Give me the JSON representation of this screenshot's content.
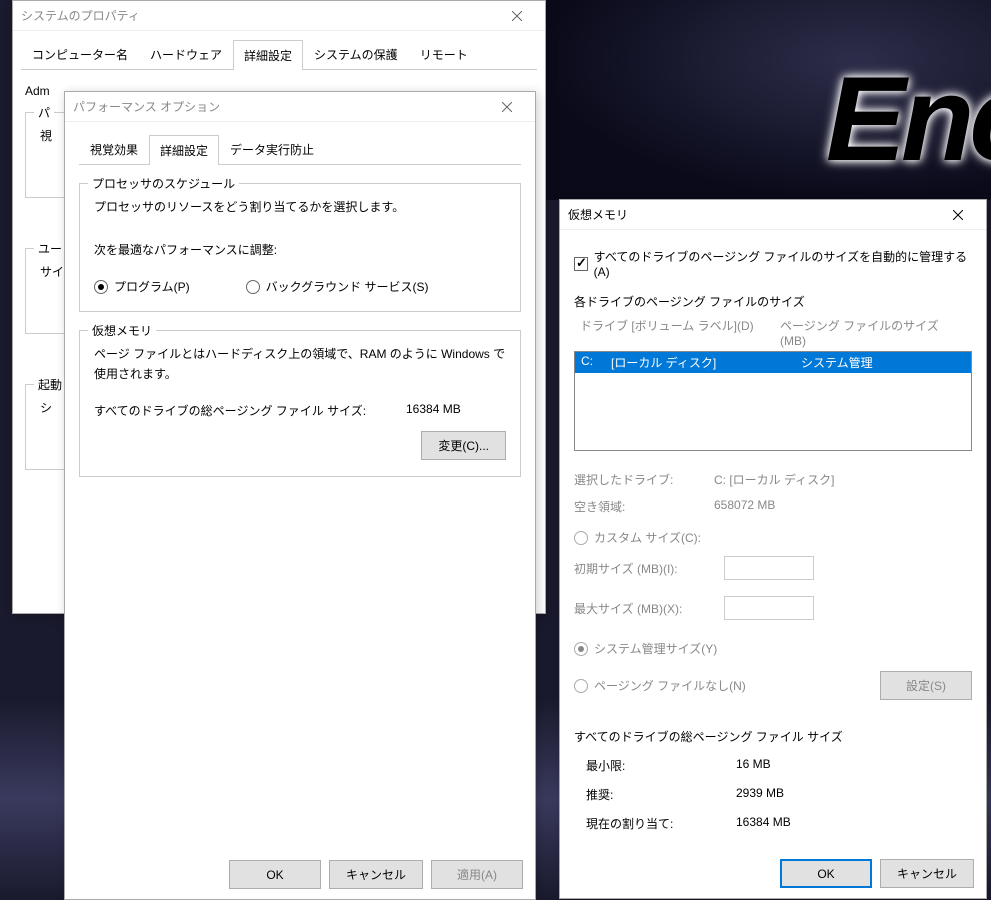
{
  "dlg1": {
    "title": "システムのプロパティ",
    "tabs": [
      "コンピューター名",
      "ハードウェア",
      "詳細設定",
      "システムの保護",
      "リモート"
    ],
    "active_tab": 2,
    "admin_label": "Adm",
    "group_perf": "パ",
    "group_perf_sub": "視",
    "group_user": "ユー",
    "group_user_sub": "サイ",
    "group_start": "起動",
    "group_start_sub": "シ"
  },
  "dlg2": {
    "title": "パフォーマンス オプション",
    "tabs": [
      "視覚効果",
      "詳細設定",
      "データ実行防止"
    ],
    "active_tab": 1,
    "processor": {
      "title": "プロセッサのスケジュール",
      "desc": "プロセッサのリソースをどう割り当てるかを選択します。",
      "adjust_label": "次を最適なパフォーマンスに調整:",
      "opt_programs": "プログラム(P)",
      "opt_background": "バックグラウンド サービス(S)"
    },
    "vm": {
      "title": "仮想メモリ",
      "desc": "ページ ファイルとはハードディスク上の領域で、RAM のように Windows で使用されます。",
      "total_label": "すべてのドライブの総ページング ファイル サイズ:",
      "total_value": "16384 MB",
      "change_btn": "変更(C)..."
    },
    "buttons": {
      "ok": "OK",
      "cancel": "キャンセル",
      "apply": "適用(A)"
    }
  },
  "dlg3": {
    "title": "仮想メモリ",
    "auto_manage": "すべてのドライブのページング ファイルのサイズを自動的に管理する(A)",
    "drives_label": "各ドライブのページング ファイルのサイズ",
    "col_drive": "ドライブ  [ボリューム ラベル](D)",
    "col_size": "ページング ファイルのサイズ (MB)",
    "drive_row": {
      "drive": "C:",
      "label": "[ローカル ディスク]",
      "size": "システム管理"
    },
    "selected_drive_label": "選択したドライブ:",
    "selected_drive_value": "C:  [ローカル ディスク]",
    "free_space_label": "空き領域:",
    "free_space_value": "658072 MB",
    "custom_size": "カスタム サイズ(C):",
    "initial_size": "初期サイズ (MB)(I):",
    "max_size": "最大サイズ (MB)(X):",
    "system_managed": "システム管理サイズ(Y)",
    "no_paging": "ページング ファイルなし(N)",
    "set_btn": "設定(S)",
    "totals_label": "すべてのドライブの総ページング ファイル サイズ",
    "min_label": "最小限:",
    "min_value": "16 MB",
    "recommended_label": "推奨:",
    "recommended_value": "2939 MB",
    "current_label": "現在の割り当て:",
    "current_value": "16384 MB",
    "ok": "OK",
    "cancel": "キャンセル"
  }
}
